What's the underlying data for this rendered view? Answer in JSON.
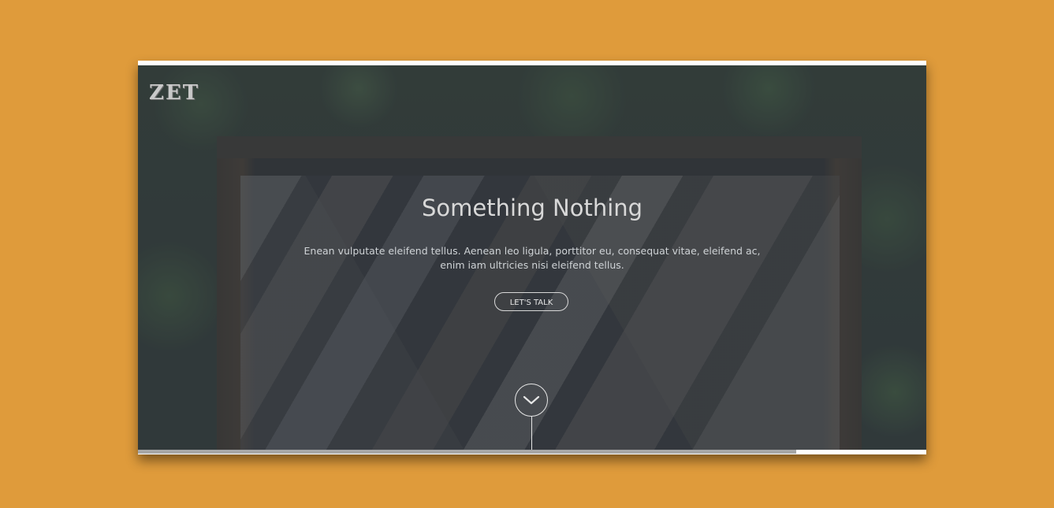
{
  "site": {
    "logo_text": "ZET"
  },
  "hero": {
    "headline": "Something Nothing",
    "description": "Enean vulputate eleifend tellus. Aenean leo ligula, porttitor eu, consequat vitae, eleifend ac, enim iam ultricies nisi eleifend tellus.",
    "cta_label": "LET'S TALK",
    "scroll_icon": "chevron-down-icon"
  },
  "progress": {
    "fraction": 0.835
  },
  "colors": {
    "background": "#df9b3b",
    "overlay": "#343c44",
    "text": "#d8d8d8",
    "progress_fill": "#a7a7a7"
  }
}
